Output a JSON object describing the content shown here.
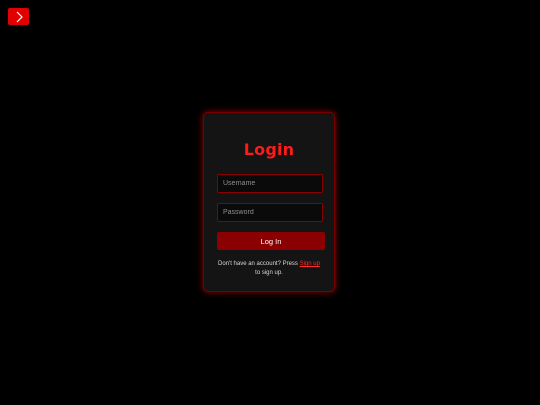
{
  "menu_toggle": {
    "icon": "chevron-right-icon",
    "color": "#e00000"
  },
  "login": {
    "title": "Login",
    "username_placeholder": "Username",
    "password_placeholder": "Password",
    "submit_label": "Log In",
    "note_prefix": "Don't have an account? Press ",
    "signup_link": "Sign up",
    "note_suffix": "to sign up."
  },
  "colors": {
    "accent": "#ff1a1a",
    "button": "#8b0000",
    "background": "#000000",
    "card": "#141414"
  }
}
